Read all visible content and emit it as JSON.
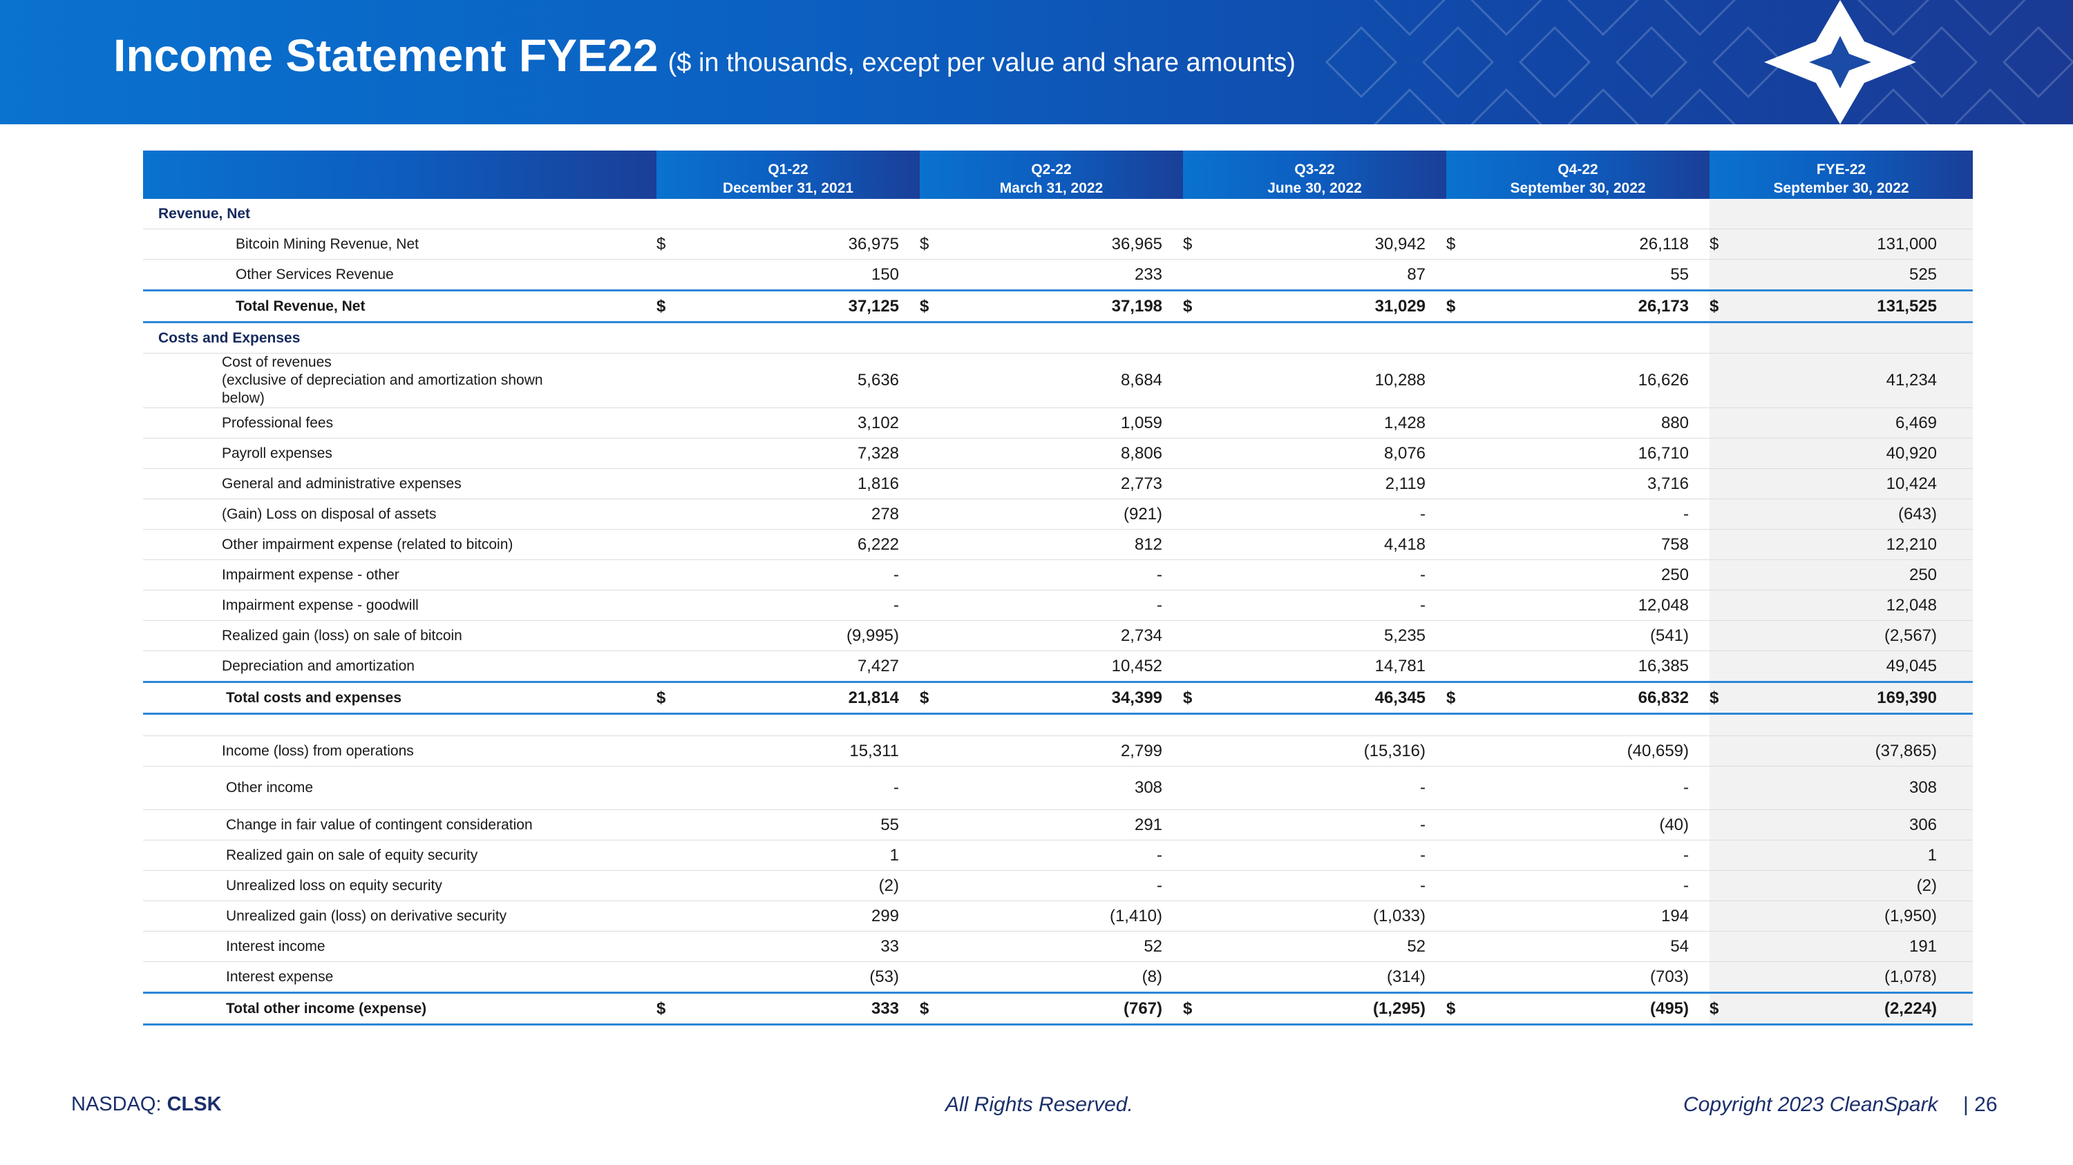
{
  "header": {
    "title": "Income Statement FYE22",
    "subtitle": "($ in thousands, except per value and share amounts)"
  },
  "columns": [
    {
      "period": "Q1-22",
      "date": "December 31, 2021"
    },
    {
      "period": "Q2-22",
      "date": "March 31, 2022"
    },
    {
      "period": "Q3-22",
      "date": "June 30, 2022"
    },
    {
      "period": "Q4-22",
      "date": "September 30, 2022"
    },
    {
      "period": "FYE-22",
      "date": "September 30, 2022"
    }
  ],
  "currency_symbol": "$",
  "sections": {
    "revenue": "Revenue, Net",
    "costs": "Costs and Expenses"
  },
  "rows": {
    "bitcoin_mining": {
      "label": "Bitcoin Mining Revenue, Net",
      "values": [
        "36,975",
        "36,965",
        "30,942",
        "26,118",
        "131,000"
      ]
    },
    "other_services": {
      "label": "Other Services Revenue",
      "values": [
        "150",
        "233",
        "87",
        "55",
        "525"
      ]
    },
    "total_revenue": {
      "label": "Total Revenue, Net",
      "values": [
        "37,125",
        "37,198",
        "31,029",
        "26,173",
        "131,525"
      ]
    },
    "cost_of_revenues": {
      "label_lines": [
        "Cost of revenues",
        "(exclusive of depreciation and amortization shown",
        "below)"
      ],
      "values": [
        "5,636",
        "8,684",
        "10,288",
        "16,626",
        "41,234"
      ]
    },
    "professional_fees": {
      "label": "Professional fees",
      "values": [
        "3,102",
        "1,059",
        "1,428",
        "880",
        "6,469"
      ]
    },
    "payroll": {
      "label": "Payroll expenses",
      "values": [
        "7,328",
        "8,806",
        "8,076",
        "16,710",
        "40,920"
      ]
    },
    "g_and_a": {
      "label": "General and administrative expenses",
      "values": [
        "1,816",
        "2,773",
        "2,119",
        "3,716",
        "10,424"
      ]
    },
    "gain_loss_disposal": {
      "label": "(Gain) Loss on disposal of assets",
      "values": [
        "278",
        "(921)",
        "-",
        "-",
        "(643)"
      ]
    },
    "other_impairment": {
      "label": "Other impairment expense (related to bitcoin)",
      "values": [
        "6,222",
        "812",
        "4,418",
        "758",
        "12,210"
      ]
    },
    "impairment_other": {
      "label": "Impairment expense - other",
      "values": [
        "-",
        "-",
        "-",
        "250",
        "250"
      ]
    },
    "impairment_goodwill": {
      "label": "Impairment expense - goodwill",
      "values": [
        "-",
        "-",
        "-",
        "12,048",
        "12,048"
      ]
    },
    "realized_bitcoin": {
      "label": "Realized gain (loss) on sale of bitcoin",
      "values": [
        "(9,995)",
        "2,734",
        "5,235",
        "(541)",
        "(2,567)"
      ]
    },
    "depreciation": {
      "label": "Depreciation and amortization",
      "values": [
        "7,427",
        "10,452",
        "14,781",
        "16,385",
        "49,045"
      ]
    },
    "total_costs": {
      "label": "Total costs and expenses",
      "values": [
        "21,814",
        "34,399",
        "46,345",
        "66,832",
        "169,390"
      ]
    },
    "income_ops": {
      "label": "Income (loss) from operations",
      "values": [
        "15,311",
        "2,799",
        "(15,316)",
        "(40,659)",
        "(37,865)"
      ]
    },
    "other_income": {
      "label": "Other income",
      "values": [
        "-",
        "308",
        "-",
        "-",
        "308"
      ]
    },
    "contingent": {
      "label": "Change in fair value of contingent consideration",
      "values": [
        "55",
        "291",
        "-",
        "(40)",
        "306"
      ]
    },
    "realized_equity": {
      "label": "Realized gain on sale of equity security",
      "values": [
        "1",
        "-",
        "-",
        "-",
        "1"
      ]
    },
    "unrealized_equity": {
      "label": "Unrealized loss on equity security",
      "values": [
        "(2)",
        "-",
        "-",
        "-",
        "(2)"
      ]
    },
    "unrealized_derivative": {
      "label": "Unrealized gain (loss) on derivative security",
      "values": [
        "299",
        "(1,410)",
        "(1,033)",
        "194",
        "(1,950)"
      ]
    },
    "interest_income": {
      "label": "Interest income",
      "values": [
        "33",
        "52",
        "52",
        "54",
        "191"
      ]
    },
    "interest_expense": {
      "label": "Interest expense",
      "values": [
        "(53)",
        "(8)",
        "(314)",
        "(703)",
        "(1,078)"
      ]
    },
    "total_other": {
      "label": "Total other income (expense)",
      "values": [
        "333",
        "(767)",
        "(1,295)",
        "(495)",
        "(2,224)"
      ]
    }
  },
  "footer": {
    "exchange_prefix": "NASDAQ: ",
    "ticker": "CLSK",
    "rights": "All Rights Reserved.",
    "copyright": "Copyright 2023 CleanSpark",
    "page": "| 26"
  },
  "colors": {
    "header_blue": "#0b5fc0",
    "dark_navy": "#152a5e",
    "rule_blue": "#2d86d6",
    "fye_shade": "#f2f2f2"
  },
  "icons": {
    "logo": "cleanspark-star-logo-icon",
    "pattern": "diamond-star-pattern-icon"
  }
}
